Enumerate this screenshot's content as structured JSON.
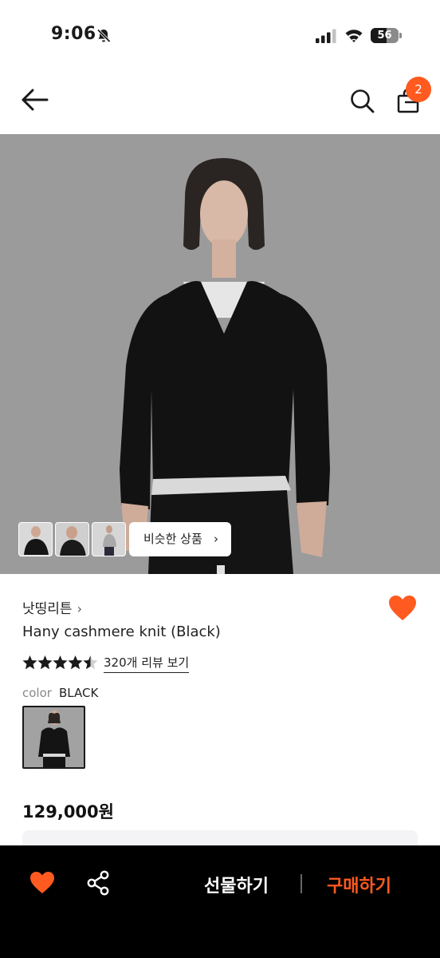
{
  "status_bar": {
    "time": "9:06",
    "battery": "56",
    "battery_level": 0.56
  },
  "header": {
    "cart_count": "2"
  },
  "gallery": {
    "similar_label": "비슷한 상품",
    "similar_chevron": "›"
  },
  "product": {
    "brand": "낫띵리튼",
    "brand_chevron": "›",
    "title": "Hany cashmere knit (Black)",
    "rating": 4.5,
    "review_link": "320개 리뷰 보기",
    "color_label": "color",
    "color_value": "BLACK",
    "price": "129,000원"
  },
  "bottom_bar": {
    "gift_label": "선물하기",
    "buy_label": "구매하기"
  },
  "colors": {
    "accent": "#ff5a1f",
    "bar_bg": "#000000"
  },
  "icons": [
    "bell-slash-icon",
    "signal-icon",
    "wifi-icon",
    "battery-icon",
    "back-arrow-icon",
    "search-icon",
    "shopping-bag-icon",
    "heart-icon",
    "star-icon",
    "share-icon"
  ]
}
